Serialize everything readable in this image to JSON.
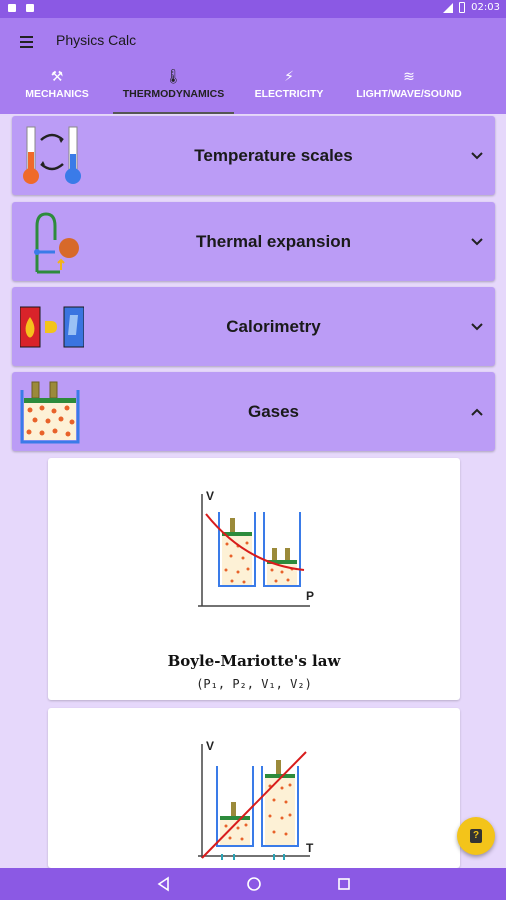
{
  "status_bar": {
    "time": "02:03"
  },
  "app_bar": {
    "title": "Physics Calc",
    "tabs": [
      {
        "label": "MECHANICS",
        "icon": "tools-icon",
        "glyph": "⚒"
      },
      {
        "label": "THERMODYNAMICS",
        "icon": "thermometer-icon",
        "glyph": "🌡"
      },
      {
        "label": "ELECTRICITY",
        "icon": "lightning-icon",
        "glyph": "⚡"
      },
      {
        "label": "LIGHT/WAVE/SOUND",
        "icon": "waves-icon",
        "glyph": "≋"
      }
    ],
    "active_tab": "THERMODYNAMICS"
  },
  "sections": [
    {
      "title": "Temperature scales",
      "icon": "thermometers-icon",
      "expanded": false
    },
    {
      "title": "Thermal expansion",
      "icon": "thermal-expansion-icon",
      "expanded": false
    },
    {
      "title": "Calorimetry",
      "icon": "calorimetry-icon",
      "expanded": false
    },
    {
      "title": "Gases",
      "icon": "gas-cylinder-icon",
      "expanded": true
    }
  ],
  "gas_cards": [
    {
      "title": "Boyle-Mariotte's law",
      "variables": "(P₁, P₂, V₁, V₂)",
      "axis_y": "V",
      "axis_x": "P"
    },
    {
      "axis_y": "V",
      "axis_x": "T"
    }
  ],
  "fab": {
    "icon": "book-icon",
    "glyph": "?"
  },
  "colors": {
    "status_bar": "#8b59e4",
    "app_bar": "#a77df0",
    "section_panel": "#bb9cf6",
    "background": "#e6d8fb",
    "fab": "#f3c41a"
  }
}
